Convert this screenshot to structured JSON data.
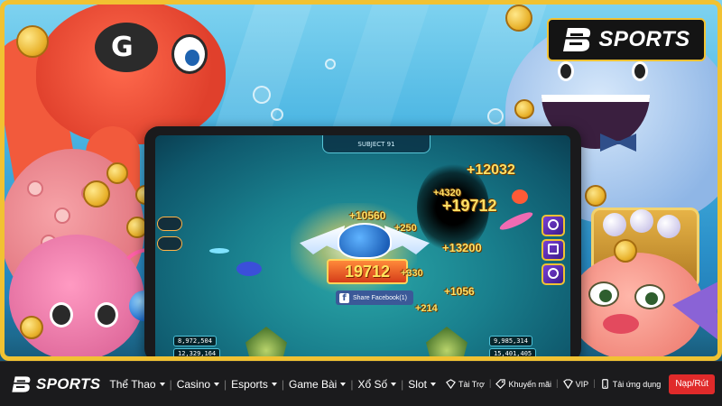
{
  "brand": {
    "name": "SPORTS",
    "accent_color": "#f1c232",
    "logo_icon": "b-sports-logo"
  },
  "banner": {
    "game": {
      "top_bar_text": "SUBJECT 91",
      "jackpot_value": "19712",
      "share_button": "Share Facebook(1)",
      "score_popups": [
        "+12032",
        "+4320",
        "+19712",
        "+10560",
        "+250",
        "+13200",
        "+330",
        "+1056",
        "+214"
      ],
      "players": [
        {
          "score": "8,972,504"
        },
        {
          "score": "12,329,164"
        },
        {
          "score": "9,985,314"
        },
        {
          "score": "15,401,405"
        }
      ]
    }
  },
  "nav": {
    "brand_text": "SPORTS",
    "menu": [
      {
        "label": "Thể Thao",
        "has_dropdown": true
      },
      {
        "label": "Casino",
        "has_dropdown": true
      },
      {
        "label": "Esports",
        "has_dropdown": true
      },
      {
        "label": "Game Bài",
        "has_dropdown": true
      },
      {
        "label": "Xổ Số",
        "has_dropdown": true
      },
      {
        "label": "Slot",
        "has_dropdown": true
      }
    ],
    "utilities": [
      {
        "label": "Tài Trợ",
        "icon": "sponsor-icon"
      },
      {
        "label": "Khuyến mãi",
        "icon": "promotion-icon"
      },
      {
        "label": "VIP",
        "icon": "vip-icon"
      },
      {
        "label": "Tải ứng dụng",
        "icon": "mobile-app-icon"
      }
    ],
    "cta_label": "Nạp/Rút",
    "cta_color": "#e02a2a"
  }
}
